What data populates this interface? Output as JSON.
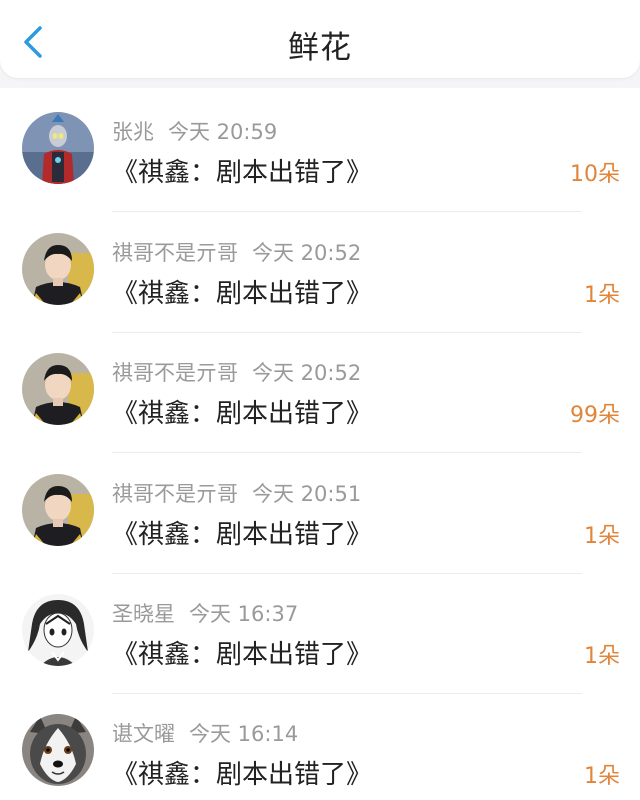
{
  "header": {
    "title": "鲜花",
    "back_icon": "chevron-left-icon",
    "accent_color": "#2b9be0"
  },
  "count_color": "#e0853a",
  "items": [
    {
      "user": "张兆",
      "time": "今天 20:59",
      "title": "《祺鑫：剧本出错了》",
      "count": "10朵",
      "avatar": "ultraman-avatar"
    },
    {
      "user": "祺哥不是亓哥",
      "time": "今天 20:52",
      "title": "《祺鑫：剧本出错了》",
      "count": "1朵",
      "avatar": "boy-photo-avatar"
    },
    {
      "user": "祺哥不是亓哥",
      "time": "今天 20:52",
      "title": "《祺鑫：剧本出错了》",
      "count": "99朵",
      "avatar": "boy-photo-avatar"
    },
    {
      "user": "祺哥不是亓哥",
      "time": "今天 20:51",
      "title": "《祺鑫：剧本出错了》",
      "count": "1朵",
      "avatar": "boy-photo-avatar"
    },
    {
      "user": "圣晓星",
      "time": "今天 16:37",
      "title": "《祺鑫：剧本出错了》",
      "count": "1朵",
      "avatar": "anime-sketch-avatar"
    },
    {
      "user": "谌文曜",
      "time": "今天 16:14",
      "title": "《祺鑫：剧本出错了》",
      "count": "1朵",
      "avatar": "husky-dog-avatar"
    }
  ]
}
